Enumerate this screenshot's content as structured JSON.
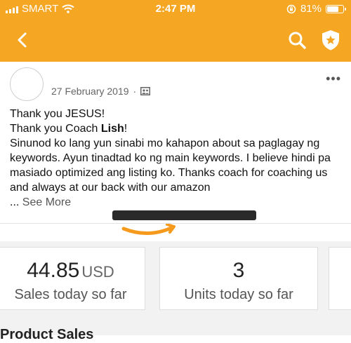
{
  "status_bar": {
    "carrier": "SMART",
    "time": "2:47 PM",
    "battery_percent": "81%",
    "battery_level": 0.81
  },
  "nav": {
    "back_icon": "chevron-left-icon",
    "search_icon": "search-icon",
    "shield_icon": "shield-star-icon",
    "bar_color": "#f5a623"
  },
  "post": {
    "date": "27 February 2019",
    "separator": "·",
    "audience_icon": "group-icon",
    "more_icon": "ellipsis-icon",
    "line1": "Thank you JESUS!",
    "line2_prefix": "Thank you Coach ",
    "line2_name": "Lish",
    "line2_suffix": "!",
    "paragraph": "Sinunod ko lang yun sinabi mo kahapon about sa paglagay ng keywords. Ayun tinadtad ko ng main keywords. I believe hindi pa masiado optimized ang listing ko. Thanks coach for coaching us and always at our back with our amazon",
    "ellipsis": "... ",
    "see_more": "See More"
  },
  "image": {
    "logo_icon": "amazon-seller-logo"
  },
  "stats": {
    "sales_value": "44.85",
    "sales_unit": "USD",
    "sales_label": "Sales today so far",
    "units_value": "3",
    "units_label": "Units today so far"
  },
  "bottom": {
    "heading": "Product Sales"
  }
}
